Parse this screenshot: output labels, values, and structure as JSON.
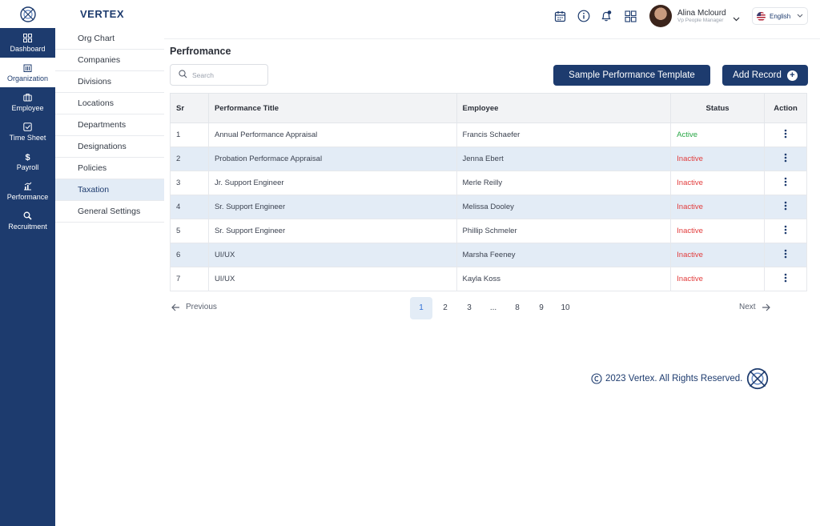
{
  "brand": {
    "name": "VERTEX"
  },
  "rail": {
    "items": [
      {
        "label": "Dashboard",
        "icon": "dashboard-icon"
      },
      {
        "label": "Organization",
        "icon": "building-icon"
      },
      {
        "label": "Employee",
        "icon": "briefcase-icon"
      },
      {
        "label": "Time Sheet",
        "icon": "checkbox-icon"
      },
      {
        "label": "Payroll",
        "icon": "dollar-icon"
      },
      {
        "label": "Performance",
        "icon": "chart-icon"
      },
      {
        "label": "Recruitment",
        "icon": "search-people-icon"
      }
    ],
    "active": "Organization"
  },
  "submenu": {
    "items": [
      "Org Chart",
      "Companies",
      "Divisions",
      "Locations",
      "Departments",
      "Designations",
      "Policies",
      "Taxation",
      "General Settings"
    ],
    "active": "Taxation"
  },
  "header": {
    "user_name": "Alina Mclourd",
    "user_role": "Vp People Manager",
    "language": "English",
    "icons": [
      "calendar-icon",
      "info-icon",
      "bell-icon",
      "grid-icon"
    ]
  },
  "main": {
    "title": "Perfromance",
    "search_placeholder": "Search",
    "template_button": "Sample Performance Template",
    "add_button": "Add Record"
  },
  "table": {
    "headers": [
      "Sr",
      "Performance Title",
      "Employee",
      "Status",
      "Action"
    ],
    "rows": [
      {
        "sr": "1",
        "title": "Annual Performance Appraisal",
        "employee": "Francis Schaefer",
        "status": "Active"
      },
      {
        "sr": "2",
        "title": "Probation Performace Appraisal",
        "employee": "Jenna Ebert",
        "status": "Inactive"
      },
      {
        "sr": "3",
        "title": "Jr. Support Engineer",
        "employee": "Merle Reilly",
        "status": "Inactive"
      },
      {
        "sr": "4",
        "title": "Sr. Support Engineer",
        "employee": "Melissa Dooley",
        "status": "Inactive"
      },
      {
        "sr": "5",
        "title": "Sr. Support Engineer",
        "employee": "Phillip Schmeler",
        "status": "Inactive"
      },
      {
        "sr": "6",
        "title": "UI/UX",
        "employee": "Marsha Feeney",
        "status": "Inactive"
      },
      {
        "sr": "7",
        "title": "UI/UX",
        "employee": "Kayla Koss",
        "status": "Inactive"
      }
    ]
  },
  "pagination": {
    "previous": "Previous",
    "next": "Next",
    "pages": [
      "1",
      "2",
      "3",
      "...",
      "8",
      "9",
      "10"
    ],
    "current": "1"
  },
  "footer": {
    "text": "2023 Vertex. All Rights Reserved."
  },
  "colors": {
    "primary": "#1d3b6e",
    "active": "#28a745",
    "inactive": "#e23c3c",
    "row_alt": "#e3ecf6"
  }
}
